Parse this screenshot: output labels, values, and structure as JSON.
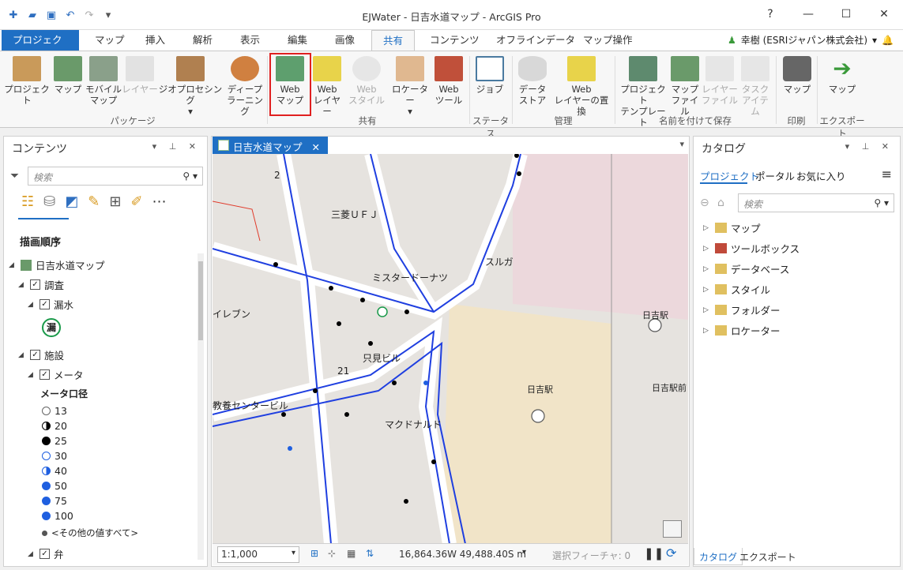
{
  "window": {
    "title": "EJWater - 日吉水道マップ - ArcGIS Pro",
    "help": "?",
    "minimize": "—",
    "maximize": "☐",
    "close": "✕"
  },
  "tabs": [
    "プロジェクト",
    "マップ",
    "挿入",
    "解析",
    "表示",
    "編集",
    "画像",
    "共有",
    "コンテンツ",
    "オフラインデータ",
    "マップ操作"
  ],
  "active_tab": "共有",
  "user": "幸樹 (ESRIジャパン株式会社)",
  "ribbon": {
    "package": {
      "items": [
        "プロジェクト",
        "マップ",
        "モバイル\nマップ",
        "レイヤー",
        "ジオプロセシング",
        "ディープ\nラーニング"
      ],
      "label": "パッケージ"
    },
    "share": {
      "items": [
        "Web\nマップ",
        "Web\nレイヤー",
        "Web\nスタイル",
        "ロケーター",
        "Web\nツール"
      ],
      "label": "共有"
    },
    "status": {
      "items": [
        "ジョブ"
      ],
      "label": "ステータス"
    },
    "manage": {
      "items": [
        "データ\nストア",
        "Web\nレイヤーの置換"
      ],
      "label": "管理"
    },
    "saveas": {
      "items": [
        "プロジェクト\nテンプレート",
        "マップ\nファイル",
        "レイヤー\nファイル",
        "タスク\nアイテム"
      ],
      "label": "名前を付けて保存"
    },
    "print": {
      "items": [
        "マップ"
      ],
      "label": "印刷"
    },
    "export": {
      "items": [
        "マップ"
      ],
      "label": "エクスポート"
    }
  },
  "contents": {
    "title": "コンテンツ",
    "search_placeholder": "検索",
    "heading": "描画順序",
    "map_name": "日吉水道マップ",
    "layer_survey": "調査",
    "layer_leak": "漏水",
    "leak_symbol": "漏",
    "layer_facility": "施設",
    "layer_meter": "メータ",
    "legend_title": "メータ口径",
    "legend": [
      "13",
      "20",
      "25",
      "30",
      "40",
      "50",
      "75",
      "100"
    ],
    "other_values": "<その他の値すべて>",
    "layer_valve": "弁"
  },
  "map": {
    "tab": "日吉水道マップ",
    "labels": [
      "2",
      "三菱ＵＦＪ",
      "スルガ",
      "ミスタードーナツ",
      "イレブン",
      "只見ビル",
      "21",
      "日吉駅",
      "日吉駅",
      "日吉駅前",
      "教養センタービル",
      "マクドナルド"
    ],
    "scale": "1:1,000",
    "coords": "16,864.36W 49,488.40S m",
    "selected": "選択フィーチャ: 0"
  },
  "catalog": {
    "title": "カタログ",
    "tabs": [
      "プロジェクト",
      "ポータル",
      "お気に入り"
    ],
    "search_placeholder": "検索",
    "items": [
      "マップ",
      "ツールボックス",
      "データベース",
      "スタイル",
      "フォルダー",
      "ロケーター"
    ],
    "bottom_tabs": [
      "カタログ",
      "エクスポート"
    ]
  }
}
